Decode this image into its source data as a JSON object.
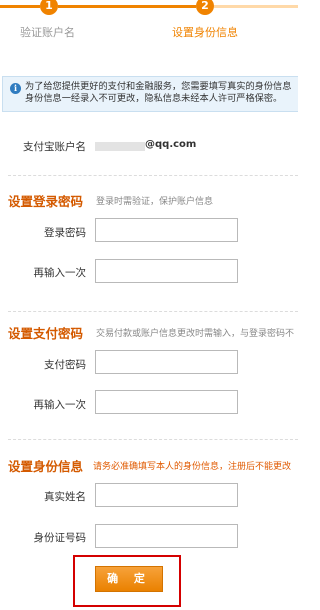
{
  "stepper": {
    "steps": [
      {
        "number": "1",
        "label": "验证账户名",
        "state": "done"
      },
      {
        "number": "2",
        "label": "设置身份信息",
        "state": "current"
      }
    ],
    "accent_color": "#f08300",
    "done_label_color": "#999999"
  },
  "notice": {
    "icon": "info-icon",
    "line1": "为了给您提供更好的支付和金融服务，您需要填写真实的身份信息",
    "line2": "身份信息一经录入不可更改，隐私信息未经本人许可严格保密。"
  },
  "account": {
    "label": "支付宝账户名",
    "value_suffix": "@qq.com"
  },
  "login_password_section": {
    "title": "设置登录密码",
    "hint": "登录时需验证，保护账户信息",
    "fields": [
      {
        "label": "登录密码",
        "value": ""
      },
      {
        "label": "再输入一次",
        "value": ""
      }
    ]
  },
  "payment_password_section": {
    "title": "设置支付密码",
    "hint": "交易付款或账户信息更改时需输入，与登录密码不",
    "fields": [
      {
        "label": "支付密码",
        "value": ""
      },
      {
        "label": "再输入一次",
        "value": ""
      }
    ]
  },
  "identity_section": {
    "title": "设置身份信息",
    "hint": "请务必准确填写本人的身份信息，注册后不能更改",
    "fields": [
      {
        "label": "真实姓名",
        "value": ""
      },
      {
        "label": "身份证号码",
        "value": ""
      }
    ]
  },
  "confirm_button": {
    "label": "确 定"
  },
  "colors": {
    "section_title": "#d45a00",
    "highlight_frame": "#d40000",
    "button": "#f08300"
  }
}
